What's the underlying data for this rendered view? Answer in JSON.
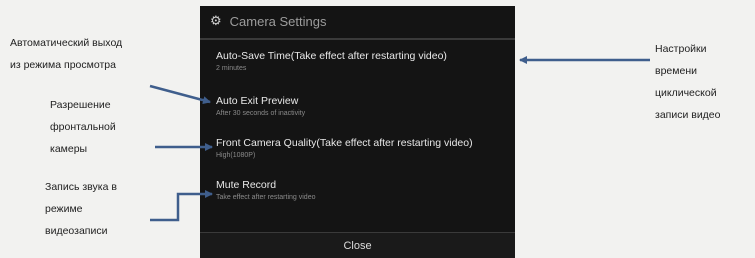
{
  "dialog": {
    "title": "Camera Settings",
    "header_icon": "gear-icon",
    "settings": [
      {
        "title": "Auto-Save Time(Take effect after restarting video)",
        "subtitle": "2 minutes"
      },
      {
        "title": "Auto Exit Preview",
        "subtitle": "After 30 seconds of inactivity"
      },
      {
        "title": "Front Camera Quality(Take effect after restarting video)",
        "subtitle": "High(1080P)"
      },
      {
        "title": "Mute Record",
        "subtitle": "Take effect after restarting video"
      }
    ],
    "close_label": "Close"
  },
  "annotations": {
    "auto_exit": [
      "Автоматический выход",
      "из режима просмотра"
    ],
    "front_quality": [
      "Разрешение",
      "фронтальной",
      "камеры"
    ],
    "mute_record": [
      "Запись звука в",
      "режиме",
      "видеозаписи"
    ],
    "auto_save": [
      "Настройки",
      "времени",
      "циклической",
      "записи видео"
    ]
  },
  "colors": {
    "dialog_background": "#141414",
    "annotation_arrow": "#3f5e8c"
  }
}
